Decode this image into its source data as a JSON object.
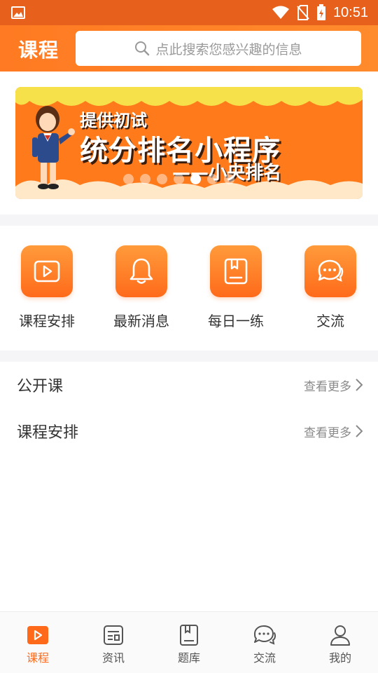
{
  "status_bar": {
    "time": "10:51",
    "icons": [
      "image-icon",
      "wifi-icon",
      "no-sim-icon",
      "battery-charging-icon"
    ]
  },
  "header": {
    "title": "课程",
    "search_placeholder": "点此搜索您感兴趣的信息"
  },
  "banner": {
    "line1": "提供初试",
    "line2": "统分排名小程序",
    "line3": "——小央排名",
    "page_count": 7,
    "active_page": 5,
    "colors": {
      "background": "#ff7a1a",
      "top_wave": "#f7e14b",
      "bottom_wave": "#ffe8c8"
    }
  },
  "quick_links": [
    {
      "label": "课程安排",
      "icon": "play-icon"
    },
    {
      "label": "最新消息",
      "icon": "bell-icon"
    },
    {
      "label": "每日一练",
      "icon": "book-icon"
    },
    {
      "label": "交流",
      "icon": "chat-icon"
    }
  ],
  "sections": [
    {
      "title": "公开课",
      "more": "查看更多"
    },
    {
      "title": "课程安排",
      "more": "查看更多"
    }
  ],
  "tabbar": {
    "items": [
      {
        "label": "课程",
        "icon": "play-icon",
        "active": true
      },
      {
        "label": "资讯",
        "icon": "news-icon",
        "active": false
      },
      {
        "label": "题库",
        "icon": "book-icon",
        "active": false
      },
      {
        "label": "交流",
        "icon": "chat-icon",
        "active": false
      },
      {
        "label": "我的",
        "icon": "user-icon",
        "active": false
      }
    ]
  },
  "colors": {
    "accent": "#ff6a1a",
    "header": "#ff7a22",
    "status_bar": "#e8611c"
  }
}
